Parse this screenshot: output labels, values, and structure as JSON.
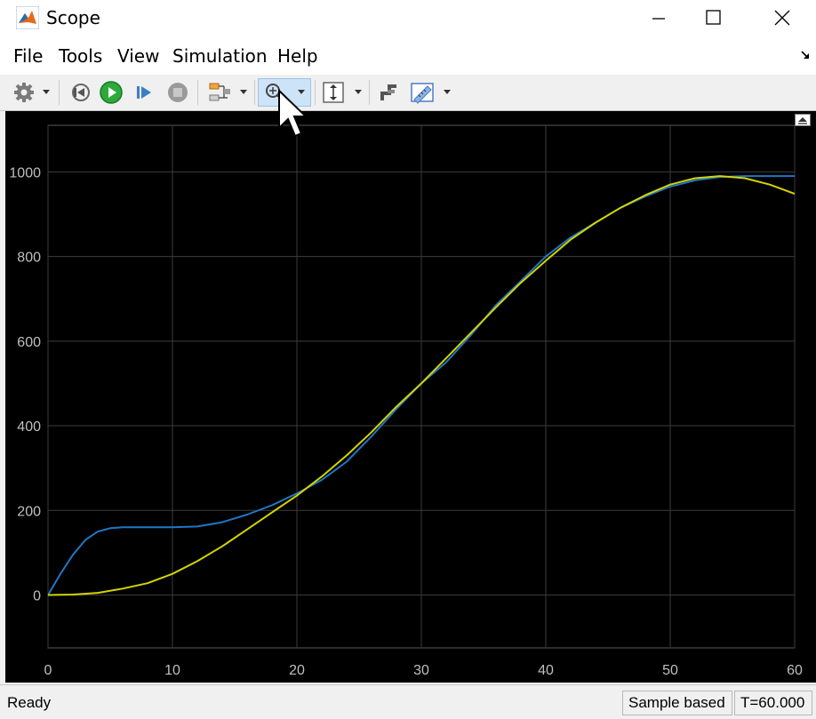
{
  "window": {
    "title": "Scope"
  },
  "menu": [
    "File",
    "Tools",
    "View",
    "Simulation",
    "Help"
  ],
  "toolbar": {
    "icons": [
      "gear-icon",
      "step-back-icon",
      "run-icon",
      "step-forward-icon",
      "stop-icon",
      "signal-selection-icon",
      "zoom-icon",
      "scale-axes-icon",
      "highlight-block-icon",
      "measurement-icon"
    ],
    "active": "zoom-icon"
  },
  "status": {
    "left": "Ready",
    "sample_mode": "Sample based",
    "time": "T=60.000"
  },
  "colors": {
    "background": "#000000",
    "grid": "#3c3c3c",
    "tick_text": "#bfbfbf",
    "series_blue": "#1f77c4",
    "series_yellow": "#d4d400"
  },
  "chart_data": {
    "type": "line",
    "xlim": [
      0,
      60
    ],
    "ylim": [
      -125,
      1110
    ],
    "xticks": [
      0,
      10,
      20,
      30,
      40,
      50,
      60
    ],
    "yticks": [
      0,
      200,
      400,
      600,
      800,
      1000
    ],
    "grid": true,
    "series": [
      {
        "color": "#1f77c4",
        "x": [
          0,
          1,
          2,
          3,
          4,
          5,
          6,
          7,
          8,
          10,
          12,
          14,
          16,
          18,
          20,
          22,
          24,
          26,
          28,
          30,
          32,
          34,
          36,
          38,
          40,
          42,
          44,
          46,
          48,
          50,
          52,
          54,
          56,
          58,
          60
        ],
        "y": [
          0,
          50,
          95,
          130,
          150,
          158,
          160,
          160,
          160,
          160,
          162,
          172,
          190,
          212,
          240,
          272,
          315,
          375,
          440,
          500,
          550,
          615,
          685,
          742,
          800,
          845,
          880,
          915,
          942,
          965,
          980,
          988,
          990,
          990,
          990
        ]
      },
      {
        "color": "#d4d400",
        "x": [
          0,
          2,
          4,
          6,
          8,
          10,
          12,
          14,
          16,
          18,
          20,
          22,
          24,
          26,
          28,
          30,
          32,
          34,
          36,
          38,
          40,
          42,
          44,
          46,
          48,
          50,
          52,
          54,
          56,
          58,
          60
        ],
        "y": [
          0,
          1,
          5,
          15,
          28,
          50,
          80,
          115,
          155,
          195,
          235,
          280,
          330,
          385,
          445,
          500,
          560,
          620,
          680,
          738,
          790,
          840,
          880,
          915,
          945,
          970,
          985,
          990,
          985,
          970,
          948
        ]
      }
    ]
  }
}
